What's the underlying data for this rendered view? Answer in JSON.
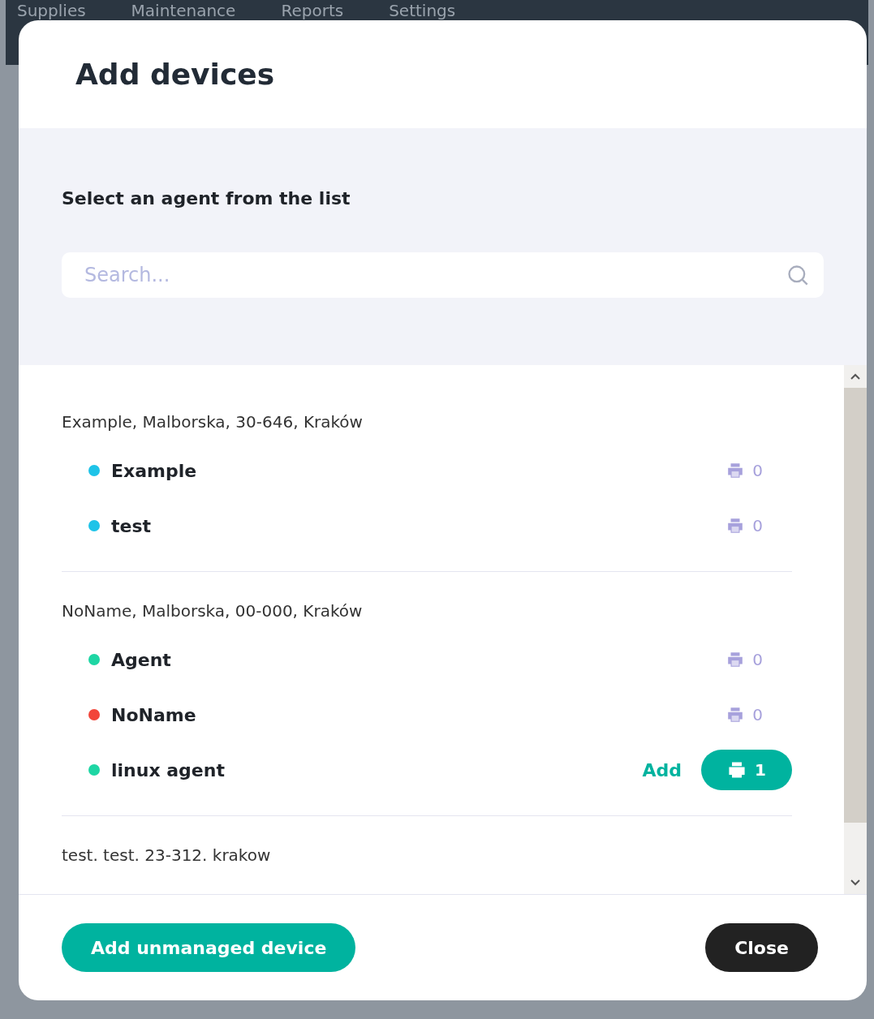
{
  "background_nav": [
    "Supplies",
    "Maintenance",
    "Reports",
    "Settings"
  ],
  "dialog": {
    "title": "Add devices",
    "prompt": "Select an agent from the list",
    "search": {
      "placeholder": "Search..."
    },
    "groups": [
      {
        "address": "Example, Malborska, 30-646, Kraków",
        "agents": [
          {
            "name": "Example",
            "color": "#1ec3e8",
            "count": "0",
            "kind": "empty"
          },
          {
            "name": "test",
            "color": "#1ec3e8",
            "count": "0",
            "kind": "empty"
          }
        ]
      },
      {
        "address": "NoName, Malborska, 00-000, Kraków",
        "agents": [
          {
            "name": "Agent",
            "color": "#1ed6a4",
            "count": "0",
            "kind": "empty"
          },
          {
            "name": "NoName",
            "color": "#f2453a",
            "count": "0",
            "kind": "empty"
          },
          {
            "name": "linux agent",
            "color": "#1ed6a4",
            "count": "1",
            "kind": "addable",
            "add_label": "Add"
          }
        ]
      },
      {
        "address": "test. test. 23-312. krakow"
      }
    ],
    "buttons": {
      "add_unmanaged": "Add unmanaged device",
      "close": "Close"
    }
  }
}
